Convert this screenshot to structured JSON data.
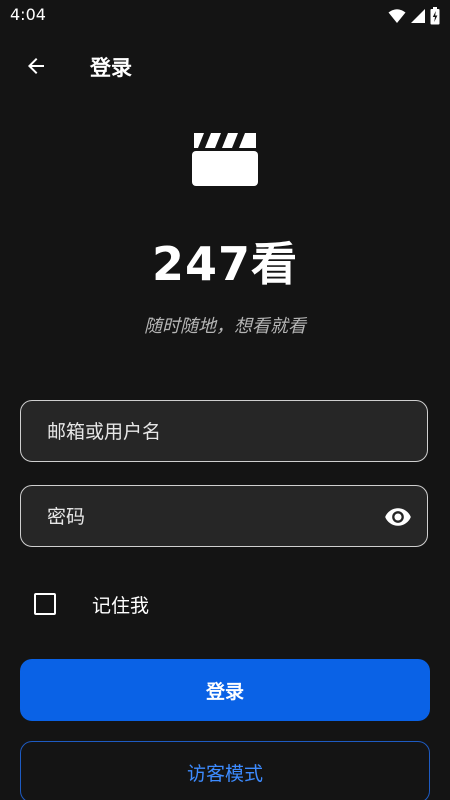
{
  "status_bar": {
    "time": "4:04",
    "icons": [
      "wifi-icon",
      "signal-icon",
      "battery-charging-icon"
    ]
  },
  "app_bar": {
    "title": "登录",
    "back_icon": "arrow-back-icon"
  },
  "brand": {
    "logo_icon": "clapperboard-icon",
    "name": "247看",
    "slogan": "随时随地，想看就看"
  },
  "form": {
    "email_placeholder": "邮箱或用户名",
    "email_value": "",
    "password_placeholder": "密码",
    "password_value": "",
    "password_toggle_icon": "eye-icon",
    "remember_label": "记住我",
    "remember_checked": false
  },
  "actions": {
    "login_label": "登录",
    "guest_label": "访客模式"
  },
  "colors": {
    "background": "#141414",
    "primary": "#0A62E6",
    "guest_text": "#3D8BFF",
    "field_bg": "#262626"
  }
}
